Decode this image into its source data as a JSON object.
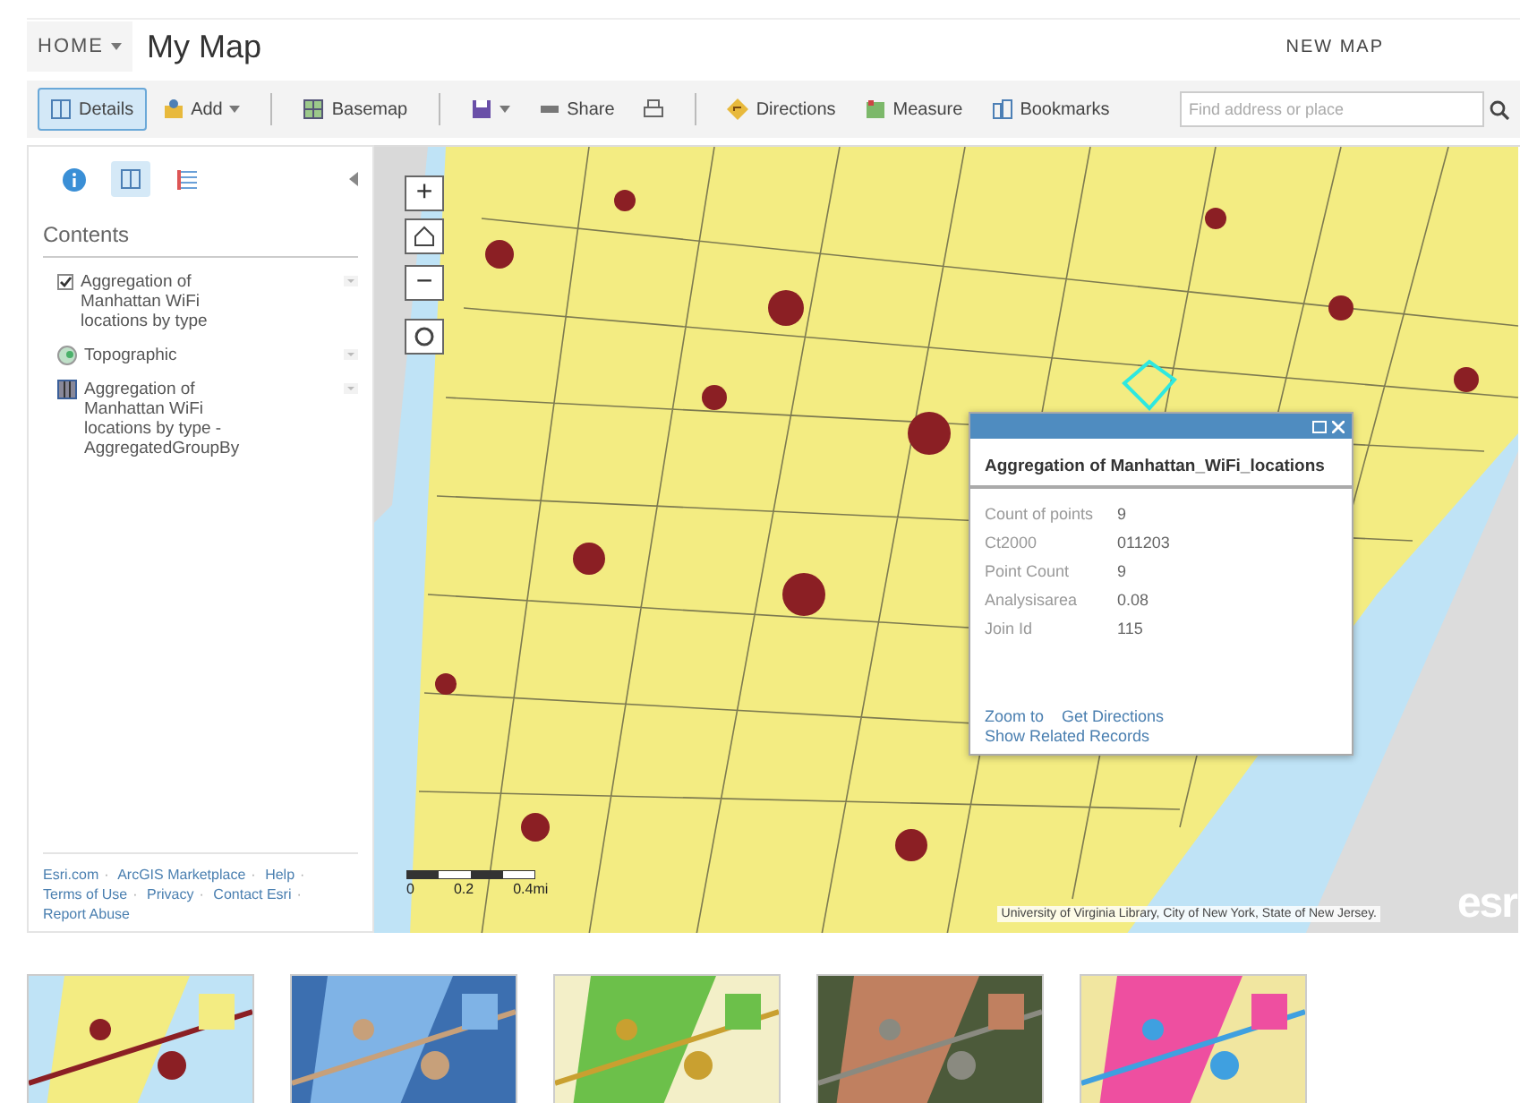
{
  "header": {
    "home": "HOME",
    "title": "My Map",
    "new_map": "NEW MAP"
  },
  "toolbar": {
    "groups": [
      [
        {
          "kind": "details",
          "label": "Details",
          "selected": true
        },
        {
          "kind": "add",
          "label": "Add",
          "selected": false
        }
      ],
      [
        {
          "kind": "basemap",
          "label": "Basemap",
          "selected": false
        }
      ],
      [
        {
          "kind": "save",
          "selected": false
        },
        {
          "kind": "share",
          "label": "Share",
          "selected": false
        },
        {
          "kind": "print",
          "selected": false
        }
      ],
      [
        {
          "kind": "directions",
          "label": "Directions",
          "selected": false
        },
        {
          "kind": "measure",
          "label": "Measure",
          "selected": false
        },
        {
          "kind": "bookmarks",
          "label": "Bookmarks",
          "selected": false
        }
      ]
    ],
    "search": {
      "placeholder": "Find address or place"
    }
  },
  "sidebar": {
    "tabs": [
      {
        "kind": "about",
        "selected": false
      },
      {
        "kind": "content",
        "selected": true
      },
      {
        "kind": "legend",
        "selected": false
      }
    ],
    "heading": "Contents",
    "layers": [
      {
        "kind": "checkbox",
        "checked": true,
        "label": "Aggregation of Manhattan WiFi locations by type"
      },
      {
        "kind": "basemap",
        "label": "Topographic"
      },
      {
        "kind": "table",
        "label": "Aggregation of Manhattan WiFi locations by type - AggregatedGroupBy"
      }
    ],
    "footer_links": [
      {
        "label": "Esri.com",
        "separator": "·"
      },
      {
        "label": "ArcGIS Marketplace",
        "separator": "·"
      },
      {
        "label": "Help",
        "separator": "·"
      },
      {
        "label": "Terms of Use",
        "separator": "·"
      },
      {
        "label": "Privacy",
        "separator": "·"
      },
      {
        "label": "Contact Esri",
        "separator": "·"
      },
      {
        "label": "Report Abuse"
      }
    ]
  },
  "map": {
    "controls": {
      "zoom_in": "+",
      "zoom_out": "−"
    },
    "popup": {
      "title": "Aggregation of Manhattan_WiFi_locations",
      "fields": [
        {
          "name": "Count of points",
          "value": "9"
        },
        {
          "name": "Ct2000",
          "value": "011203"
        },
        {
          "name": "Point Count",
          "value": "9"
        },
        {
          "name": "Analysisarea",
          "value": "0.08"
        },
        {
          "name": "Join Id",
          "value": "115"
        }
      ],
      "links": [
        "Zoom to",
        "Get Directions",
        "Show Related Records"
      ]
    },
    "scale": [
      "0",
      "0.2",
      "0.4mi"
    ],
    "attribution": "University of Virginia Library, City of New York, State of New Jersey.",
    "logo": "esr"
  }
}
